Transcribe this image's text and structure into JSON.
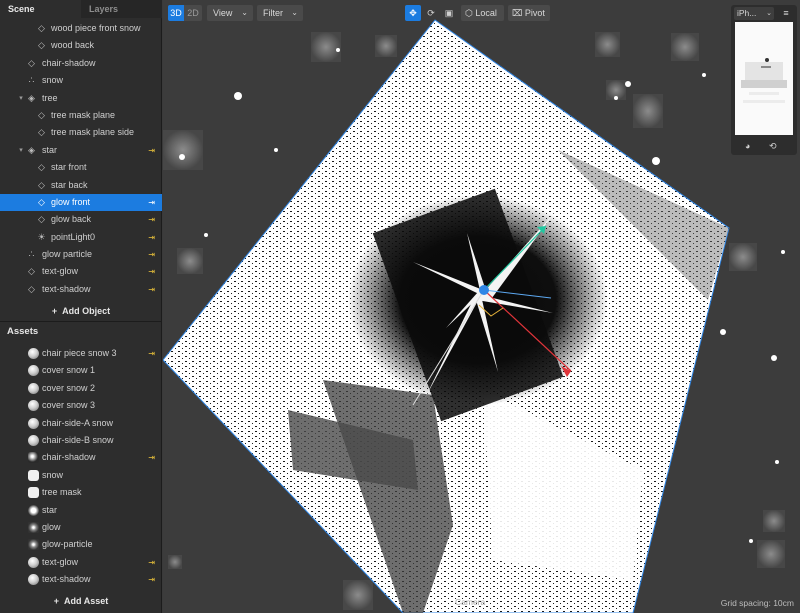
{
  "panel_tabs": {
    "scene": "Scene",
    "layers": "Layers"
  },
  "scene_tree": [
    {
      "label": "wood piece front snow",
      "indent": 2,
      "icon": "mesh-icon",
      "flag": false,
      "arrow": ""
    },
    {
      "label": "wood back",
      "indent": 2,
      "icon": "mesh-icon",
      "flag": false,
      "arrow": ""
    },
    {
      "label": "chair-shadow",
      "indent": 1,
      "icon": "mesh-icon",
      "flag": false,
      "arrow": ""
    },
    {
      "label": "snow",
      "indent": 1,
      "icon": "particles-icon",
      "flag": false,
      "arrow": ""
    },
    {
      "label": "tree",
      "indent": 1,
      "icon": "group-icon",
      "flag": false,
      "arrow": "expanded"
    },
    {
      "label": "tree mask plane",
      "indent": 2,
      "icon": "mesh-icon",
      "flag": false,
      "arrow": ""
    },
    {
      "label": "tree mask plane side",
      "indent": 2,
      "icon": "mesh-icon",
      "flag": false,
      "arrow": ""
    },
    {
      "label": "star",
      "indent": 1,
      "icon": "group-icon",
      "flag": true,
      "arrow": "expanded"
    },
    {
      "label": "star front",
      "indent": 2,
      "icon": "mesh-icon",
      "flag": false,
      "arrow": ""
    },
    {
      "label": "star back",
      "indent": 2,
      "icon": "mesh-icon",
      "flag": false,
      "arrow": ""
    },
    {
      "label": "glow front",
      "indent": 2,
      "icon": "mesh-icon",
      "flag": true,
      "arrow": "",
      "selected": true
    },
    {
      "label": "glow back",
      "indent": 2,
      "icon": "mesh-icon",
      "flag": true,
      "arrow": ""
    },
    {
      "label": "pointLight0",
      "indent": 2,
      "icon": "light-icon",
      "flag": true,
      "arrow": ""
    },
    {
      "label": "glow particle",
      "indent": 1,
      "icon": "particles-icon",
      "flag": true,
      "arrow": ""
    },
    {
      "label": "text-glow",
      "indent": 1,
      "icon": "mesh-icon",
      "flag": true,
      "arrow": ""
    },
    {
      "label": "text-shadow",
      "indent": 1,
      "icon": "mesh-icon",
      "flag": true,
      "arrow": ""
    }
  ],
  "add_object": "Add Object",
  "assets_title": "Assets",
  "assets": [
    {
      "label": "chair piece snow 3",
      "thumb": "sphere",
      "flag": true
    },
    {
      "label": "cover snow 1",
      "thumb": "sphere",
      "flag": false
    },
    {
      "label": "cover snow 2",
      "thumb": "sphere",
      "flag": false
    },
    {
      "label": "cover snow 3",
      "thumb": "sphere",
      "flag": false
    },
    {
      "label": "chair-side-A snow",
      "thumb": "sphere",
      "flag": false
    },
    {
      "label": "chair-side-B snow",
      "thumb": "sphere",
      "flag": false
    },
    {
      "label": "chair-shadow",
      "thumb": "dark",
      "flag": true
    },
    {
      "label": "snow",
      "thumb": "flat",
      "flag": false
    },
    {
      "label": "tree mask",
      "thumb": "flat",
      "flag": false
    },
    {
      "label": "star",
      "thumb": "star",
      "flag": false
    },
    {
      "label": "glow",
      "thumb": "glow",
      "flag": false
    },
    {
      "label": "glow-particle",
      "thumb": "glow",
      "flag": false
    },
    {
      "label": "text-glow",
      "thumb": "sphere",
      "flag": true
    },
    {
      "label": "text-shadow",
      "thumb": "sphere",
      "flag": true
    }
  ],
  "add_asset": "Add Asset",
  "toolbar": {
    "mode_3d": "3D",
    "mode_2d": "2D",
    "view": "View",
    "filter": "Filter",
    "local": "Local",
    "pivot": "Pivot"
  },
  "preview": {
    "device": "iPh..."
  },
  "camera_label": "Camera",
  "grid_spacing": "Grid spacing: 10cm",
  "colors": {
    "accent": "#1c7ce0",
    "flag": "#e9c13a",
    "axis_x": "#e0343a",
    "axis_y": "#22c7a0",
    "axis_z": "#2f86e6"
  }
}
